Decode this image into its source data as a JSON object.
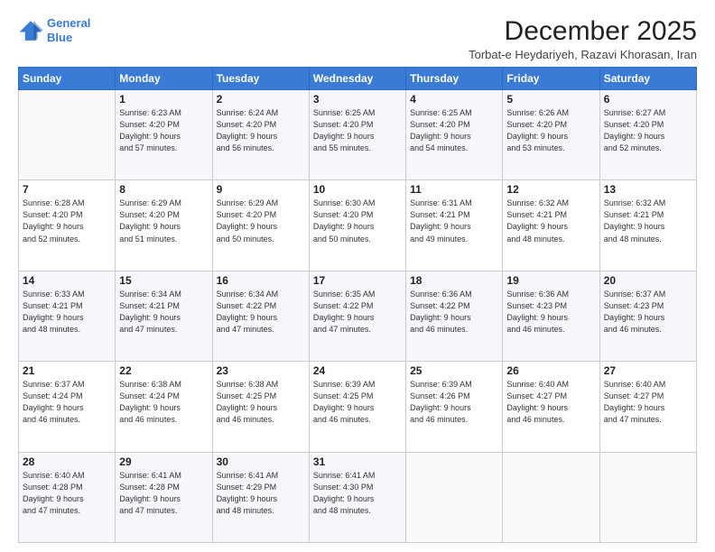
{
  "logo": {
    "line1": "General",
    "line2": "Blue"
  },
  "header": {
    "month": "December 2025",
    "location": "Torbat-e Heydariyeh, Razavi Khorasan, Iran"
  },
  "days_of_week": [
    "Sunday",
    "Monday",
    "Tuesday",
    "Wednesday",
    "Thursday",
    "Friday",
    "Saturday"
  ],
  "weeks": [
    [
      {
        "day": "",
        "info": ""
      },
      {
        "day": "1",
        "info": "Sunrise: 6:23 AM\nSunset: 4:20 PM\nDaylight: 9 hours\nand 57 minutes."
      },
      {
        "day": "2",
        "info": "Sunrise: 6:24 AM\nSunset: 4:20 PM\nDaylight: 9 hours\nand 56 minutes."
      },
      {
        "day": "3",
        "info": "Sunrise: 6:25 AM\nSunset: 4:20 PM\nDaylight: 9 hours\nand 55 minutes."
      },
      {
        "day": "4",
        "info": "Sunrise: 6:25 AM\nSunset: 4:20 PM\nDaylight: 9 hours\nand 54 minutes."
      },
      {
        "day": "5",
        "info": "Sunrise: 6:26 AM\nSunset: 4:20 PM\nDaylight: 9 hours\nand 53 minutes."
      },
      {
        "day": "6",
        "info": "Sunrise: 6:27 AM\nSunset: 4:20 PM\nDaylight: 9 hours\nand 52 minutes."
      }
    ],
    [
      {
        "day": "7",
        "info": "Sunrise: 6:28 AM\nSunset: 4:20 PM\nDaylight: 9 hours\nand 52 minutes."
      },
      {
        "day": "8",
        "info": "Sunrise: 6:29 AM\nSunset: 4:20 PM\nDaylight: 9 hours\nand 51 minutes."
      },
      {
        "day": "9",
        "info": "Sunrise: 6:29 AM\nSunset: 4:20 PM\nDaylight: 9 hours\nand 50 minutes."
      },
      {
        "day": "10",
        "info": "Sunrise: 6:30 AM\nSunset: 4:20 PM\nDaylight: 9 hours\nand 50 minutes."
      },
      {
        "day": "11",
        "info": "Sunrise: 6:31 AM\nSunset: 4:21 PM\nDaylight: 9 hours\nand 49 minutes."
      },
      {
        "day": "12",
        "info": "Sunrise: 6:32 AM\nSunset: 4:21 PM\nDaylight: 9 hours\nand 48 minutes."
      },
      {
        "day": "13",
        "info": "Sunrise: 6:32 AM\nSunset: 4:21 PM\nDaylight: 9 hours\nand 48 minutes."
      }
    ],
    [
      {
        "day": "14",
        "info": "Sunrise: 6:33 AM\nSunset: 4:21 PM\nDaylight: 9 hours\nand 48 minutes."
      },
      {
        "day": "15",
        "info": "Sunrise: 6:34 AM\nSunset: 4:21 PM\nDaylight: 9 hours\nand 47 minutes."
      },
      {
        "day": "16",
        "info": "Sunrise: 6:34 AM\nSunset: 4:22 PM\nDaylight: 9 hours\nand 47 minutes."
      },
      {
        "day": "17",
        "info": "Sunrise: 6:35 AM\nSunset: 4:22 PM\nDaylight: 9 hours\nand 47 minutes."
      },
      {
        "day": "18",
        "info": "Sunrise: 6:36 AM\nSunset: 4:22 PM\nDaylight: 9 hours\nand 46 minutes."
      },
      {
        "day": "19",
        "info": "Sunrise: 6:36 AM\nSunset: 4:23 PM\nDaylight: 9 hours\nand 46 minutes."
      },
      {
        "day": "20",
        "info": "Sunrise: 6:37 AM\nSunset: 4:23 PM\nDaylight: 9 hours\nand 46 minutes."
      }
    ],
    [
      {
        "day": "21",
        "info": "Sunrise: 6:37 AM\nSunset: 4:24 PM\nDaylight: 9 hours\nand 46 minutes."
      },
      {
        "day": "22",
        "info": "Sunrise: 6:38 AM\nSunset: 4:24 PM\nDaylight: 9 hours\nand 46 minutes."
      },
      {
        "day": "23",
        "info": "Sunrise: 6:38 AM\nSunset: 4:25 PM\nDaylight: 9 hours\nand 46 minutes."
      },
      {
        "day": "24",
        "info": "Sunrise: 6:39 AM\nSunset: 4:25 PM\nDaylight: 9 hours\nand 46 minutes."
      },
      {
        "day": "25",
        "info": "Sunrise: 6:39 AM\nSunset: 4:26 PM\nDaylight: 9 hours\nand 46 minutes."
      },
      {
        "day": "26",
        "info": "Sunrise: 6:40 AM\nSunset: 4:27 PM\nDaylight: 9 hours\nand 46 minutes."
      },
      {
        "day": "27",
        "info": "Sunrise: 6:40 AM\nSunset: 4:27 PM\nDaylight: 9 hours\nand 47 minutes."
      }
    ],
    [
      {
        "day": "28",
        "info": "Sunrise: 6:40 AM\nSunset: 4:28 PM\nDaylight: 9 hours\nand 47 minutes."
      },
      {
        "day": "29",
        "info": "Sunrise: 6:41 AM\nSunset: 4:28 PM\nDaylight: 9 hours\nand 47 minutes."
      },
      {
        "day": "30",
        "info": "Sunrise: 6:41 AM\nSunset: 4:29 PM\nDaylight: 9 hours\nand 48 minutes."
      },
      {
        "day": "31",
        "info": "Sunrise: 6:41 AM\nSunset: 4:30 PM\nDaylight: 9 hours\nand 48 minutes."
      },
      {
        "day": "",
        "info": ""
      },
      {
        "day": "",
        "info": ""
      },
      {
        "day": "",
        "info": ""
      }
    ]
  ]
}
